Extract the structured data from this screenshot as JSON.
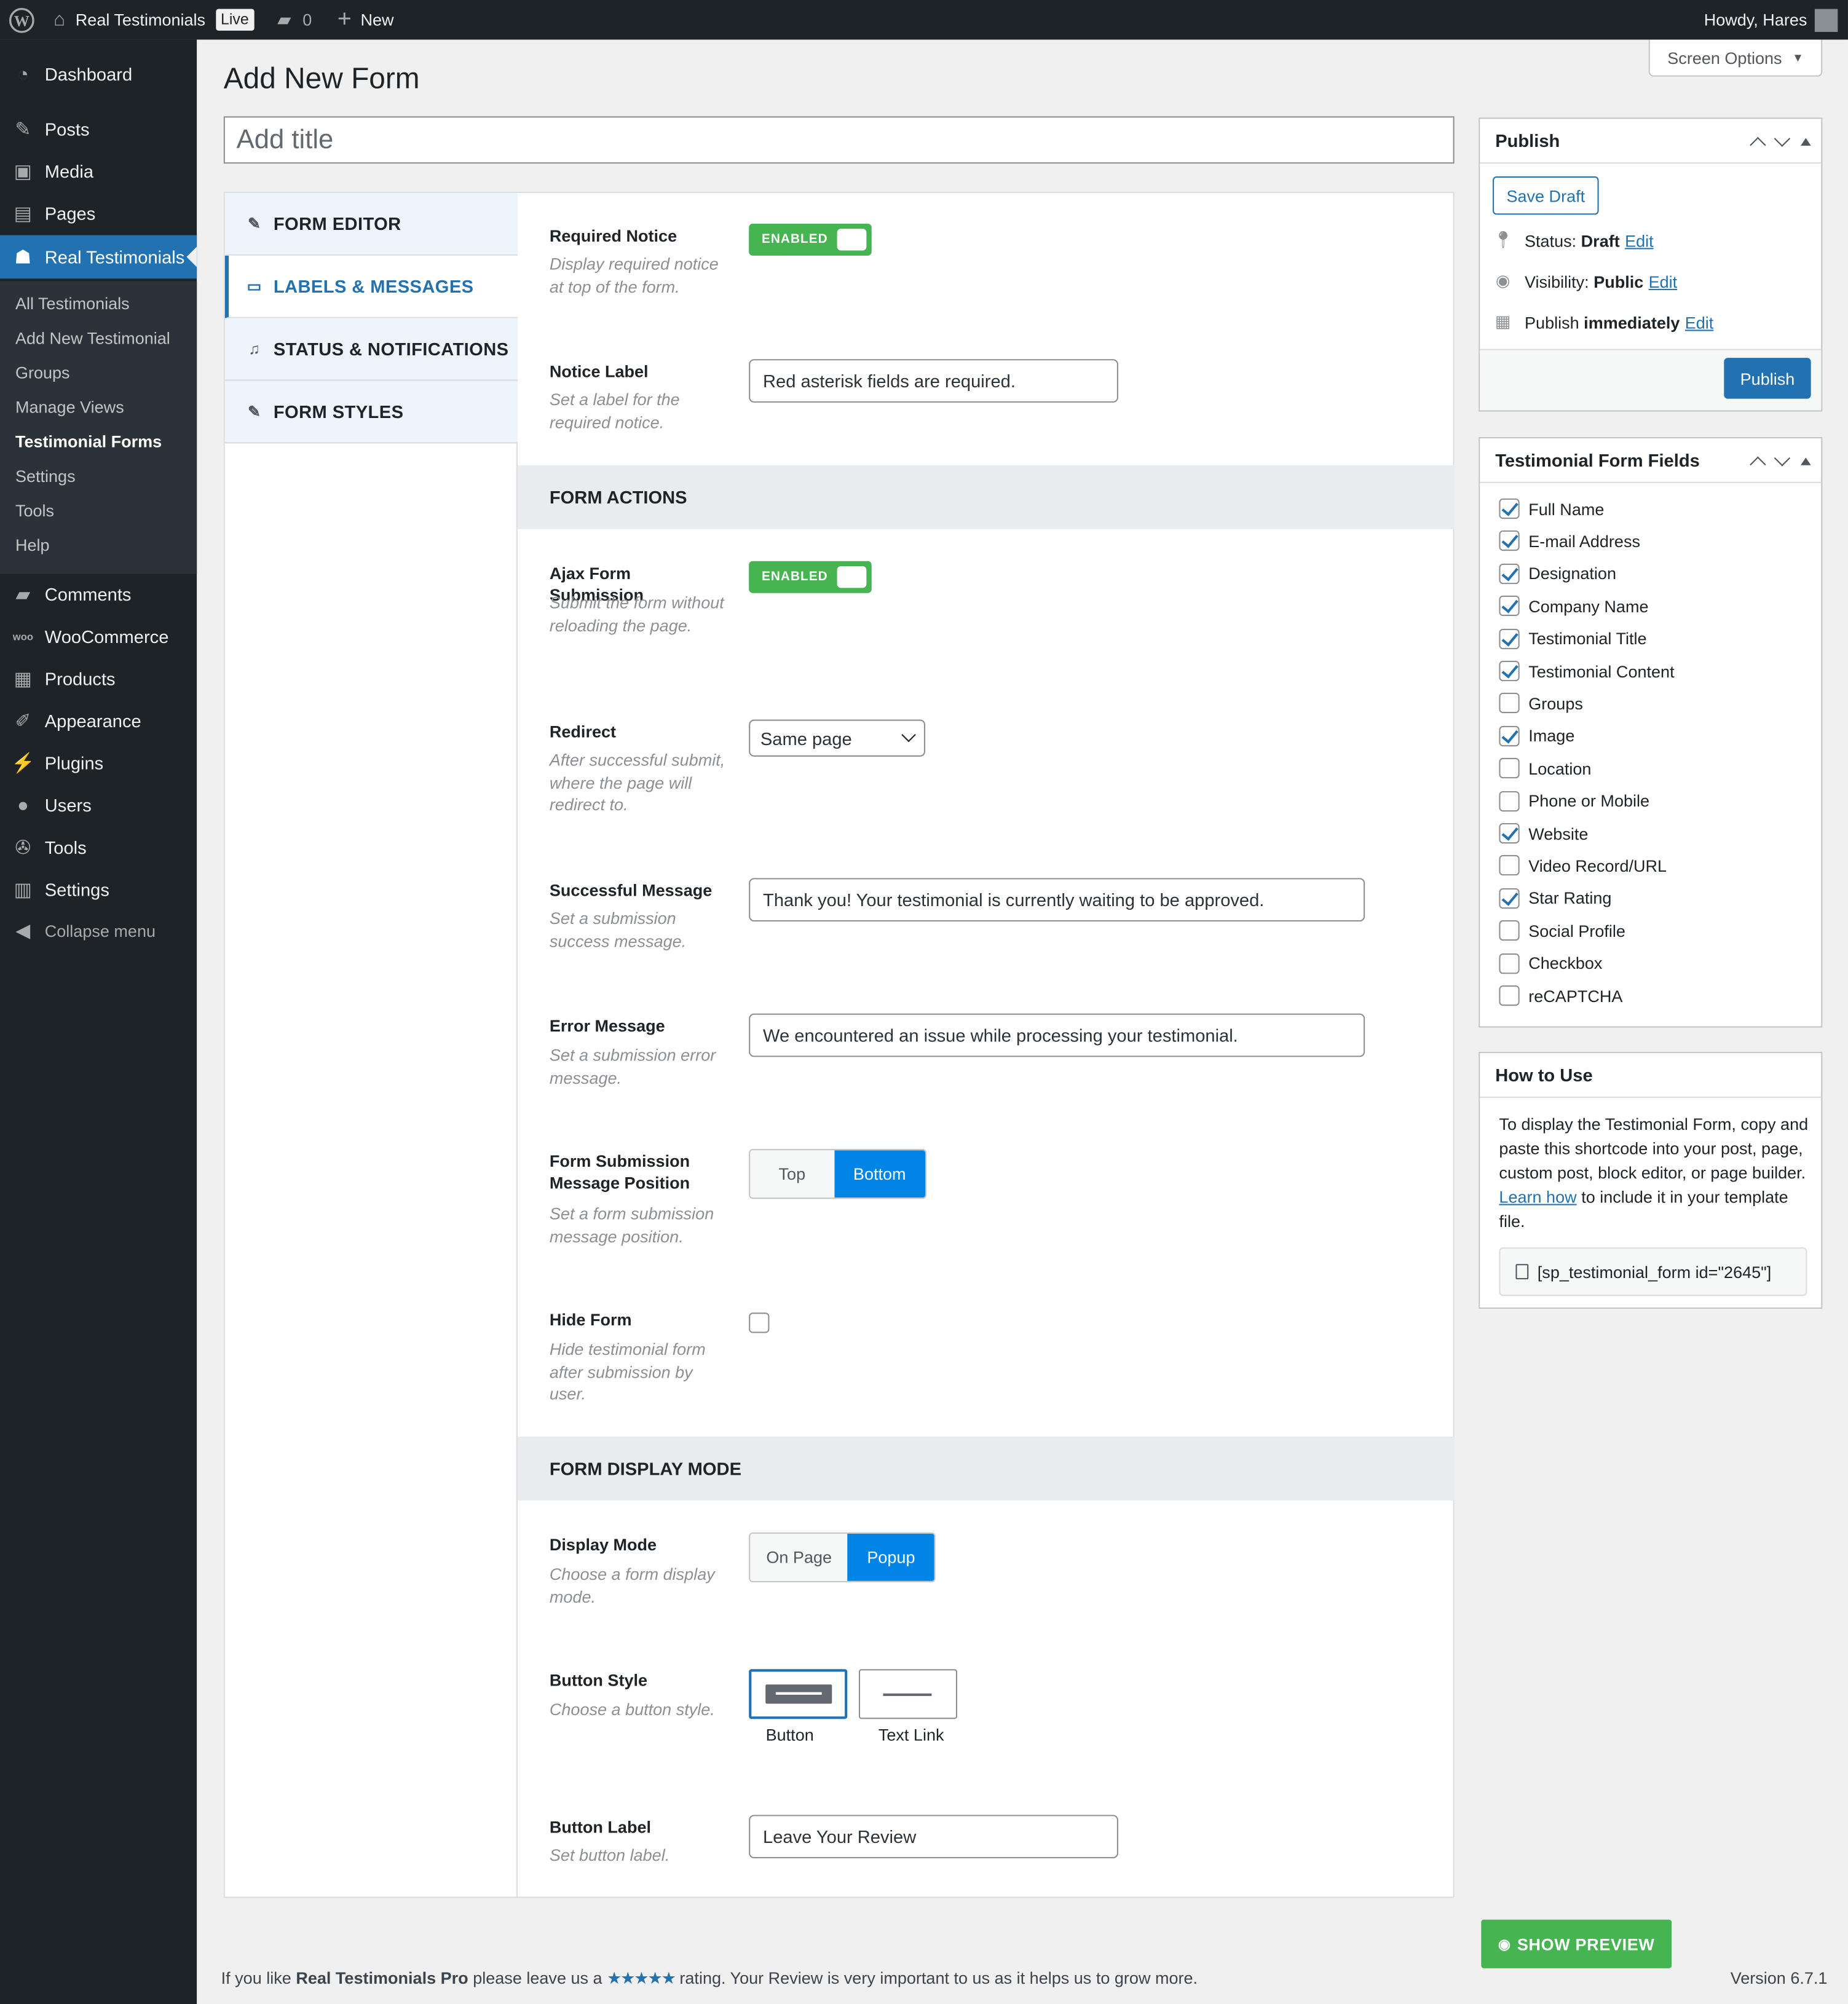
{
  "admin_bar": {
    "site_name": "Real Testimonials",
    "live_badge": "Live",
    "comments_count": "0",
    "new_label": "New",
    "howdy": "Howdy, Hares"
  },
  "sidebar": {
    "items": [
      {
        "label": "Dashboard",
        "icon": "dashboard-icon"
      },
      {
        "label": "Posts",
        "icon": "pin-icon"
      },
      {
        "label": "Media",
        "icon": "media-icon"
      },
      {
        "label": "Pages",
        "icon": "pages-icon"
      },
      {
        "label": "Real Testimonials",
        "icon": "testimonials-icon"
      },
      {
        "label": "Comments",
        "icon": "comments-icon"
      },
      {
        "label": "WooCommerce",
        "icon": "woocommerce-icon"
      },
      {
        "label": "Products",
        "icon": "products-icon"
      },
      {
        "label": "Appearance",
        "icon": "appearance-icon"
      },
      {
        "label": "Plugins",
        "icon": "plugins-icon"
      },
      {
        "label": "Users",
        "icon": "users-icon"
      },
      {
        "label": "Tools",
        "icon": "tools-icon"
      },
      {
        "label": "Settings",
        "icon": "settings-icon"
      },
      {
        "label": "Collapse menu",
        "icon": "collapse-icon"
      }
    ],
    "submenu": [
      "All Testimonials",
      "Add New Testimonial",
      "Groups",
      "Manage Views",
      "Testimonial Forms",
      "Settings",
      "Tools",
      "Help"
    ]
  },
  "page": {
    "title": "Add New Form",
    "screen_options": "Screen Options",
    "title_placeholder": "Add title"
  },
  "tabs": [
    "FORM EDITOR",
    "LABELS & MESSAGES",
    "STATUS & NOTIFICATIONS",
    "FORM STYLES"
  ],
  "fields": {
    "required_notice": {
      "label": "Required Notice",
      "desc": "Display required notice at top of the form.",
      "toggle": "ENABLED"
    },
    "notice_label": {
      "label": "Notice Label",
      "desc": "Set a label for the required notice.",
      "value": "Red asterisk fields are required."
    },
    "form_actions_heading": "FORM ACTIONS",
    "ajax": {
      "label": "Ajax Form Submission",
      "desc": "Submit the form without reloading the page.",
      "toggle": "ENABLED"
    },
    "redirect": {
      "label": "Redirect",
      "desc": "After successful submit, where the page will redirect to.",
      "value": "Same page"
    },
    "success": {
      "label": "Successful Message",
      "desc": "Set a submission success message.",
      "value": "Thank you! Your testimonial is currently waiting to be approved."
    },
    "error": {
      "label": "Error Message",
      "desc": "Set a submission error message.",
      "value": "We encountered an issue while processing your testimonial."
    },
    "position": {
      "label": "Form Submission Message Position",
      "desc": "Set a form submission message position.",
      "options": [
        "Top",
        "Bottom"
      ],
      "selected": "Bottom"
    },
    "hide_form": {
      "label": "Hide Form",
      "desc": "Hide testimonial form after submission by user.",
      "checked": false
    },
    "display_heading": "FORM DISPLAY MODE",
    "display_mode": {
      "label": "Display Mode",
      "desc": "Choose a form display mode.",
      "options": [
        "On Page",
        "Popup"
      ],
      "selected": "Popup"
    },
    "button_style": {
      "label": "Button Style",
      "desc": "Choose a button style.",
      "options": [
        "Button",
        "Text Link"
      ],
      "selected": "Button"
    },
    "button_label": {
      "label": "Button Label",
      "desc": "Set button label.",
      "value": "Leave Your Review"
    }
  },
  "publish": {
    "heading": "Publish",
    "save_draft": "Save Draft",
    "status_label": "Status:",
    "status_value": "Draft",
    "visibility_label": "Visibility:",
    "visibility_value": "Public",
    "publish_label": "Publish",
    "publish_value": "immediately",
    "edit": "Edit",
    "publish_button": "Publish"
  },
  "form_fields": {
    "heading": "Testimonial Form Fields",
    "items": [
      {
        "label": "Full Name",
        "checked": true
      },
      {
        "label": "E-mail Address",
        "checked": true
      },
      {
        "label": "Designation",
        "checked": true
      },
      {
        "label": "Company Name",
        "checked": true
      },
      {
        "label": "Testimonial Title",
        "checked": true
      },
      {
        "label": "Testimonial Content",
        "checked": true
      },
      {
        "label": "Groups",
        "checked": false
      },
      {
        "label": "Image",
        "checked": true
      },
      {
        "label": "Location",
        "checked": false
      },
      {
        "label": "Phone or Mobile",
        "checked": false
      },
      {
        "label": "Website",
        "checked": true
      },
      {
        "label": "Video Record/URL",
        "checked": false
      },
      {
        "label": "Star Rating",
        "checked": true
      },
      {
        "label": "Social Profile",
        "checked": false
      },
      {
        "label": "Checkbox",
        "checked": false
      },
      {
        "label": "reCAPTCHA",
        "checked": false
      }
    ]
  },
  "how_to": {
    "heading": "How to Use",
    "text_before": "To display the Testimonial Form, copy and paste this shortcode into your post, page, custom post, block editor, or page builder.",
    "link": "Learn how",
    "text_after": "to include it in your template file.",
    "shortcode": "[sp_testimonial_form id=\"2645\"]"
  },
  "preview_button": "SHOW PREVIEW",
  "footer": {
    "left_1": "If you like",
    "left_brand": "Real Testimonials Pro",
    "left_2": "please leave us a",
    "stars": "★★★★★",
    "left_3": "rating. Your Review is very important to us as it helps us to grow more.",
    "version": "Version 6.7.1"
  },
  "colors": {
    "accent": "#2271b1",
    "enabled": "#46b450",
    "segment_on": "#0085e6",
    "adminbar": "#1d2327"
  }
}
